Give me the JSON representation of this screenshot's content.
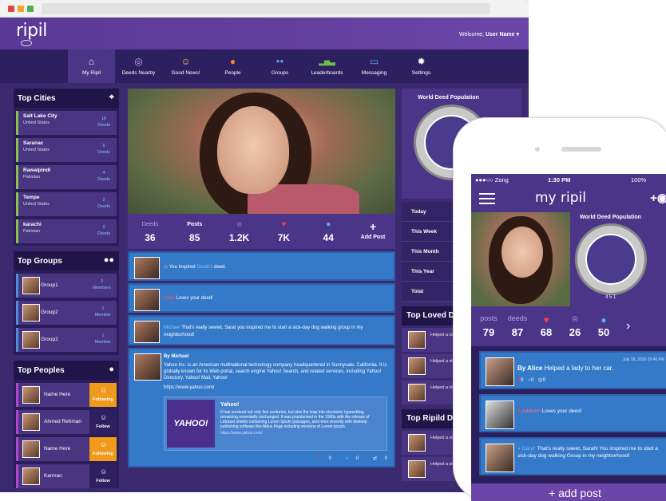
{
  "desktop": {
    "logo": "ripil",
    "welcome": "Welcome,",
    "welcome_user": "User Name ▾",
    "nav": [
      {
        "label": "My Ripil",
        "icon": "home-icon",
        "glyph": "⌂"
      },
      {
        "label": "Deeds Nearby",
        "icon": "ripple-icon",
        "glyph": "◎"
      },
      {
        "label": "Good News!",
        "icon": "smile-icon",
        "glyph": "☺"
      },
      {
        "label": "People",
        "icon": "person-icon",
        "glyph": "●"
      },
      {
        "label": "Groups",
        "icon": "group-icon",
        "glyph": "●●"
      },
      {
        "label": "Leaderboards",
        "icon": "bar-chart-icon",
        "glyph": "▂▅▃"
      },
      {
        "label": "Messaging",
        "icon": "chat-icon",
        "glyph": "▭"
      },
      {
        "label": "Settings",
        "icon": "gear-icon",
        "glyph": "✹"
      }
    ],
    "top_cities": {
      "title": "Top Cities",
      "items": [
        {
          "city": "Salt Lake City",
          "country": "United States",
          "count": "18",
          "unit": "Deeds"
        },
        {
          "city": "Saranac",
          "country": "United States",
          "count": "6",
          "unit": "Deeds"
        },
        {
          "city": "Rawalpindi",
          "country": "Pakistan",
          "count": "4",
          "unit": "Deeds"
        },
        {
          "city": "Tempe",
          "country": "United States",
          "count": "2",
          "unit": "Deeds"
        },
        {
          "city": "karachi",
          "country": "Pakistan",
          "count": "2",
          "unit": "Deeds"
        }
      ]
    },
    "top_groups": {
      "title": "Top Groups",
      "items": [
        {
          "name": "Group1",
          "count": "2",
          "unit": "Members"
        },
        {
          "name": "Group2",
          "count": "1",
          "unit": "Member"
        },
        {
          "name": "Group2",
          "count": "1",
          "unit": "Member"
        }
      ]
    },
    "top_peoples": {
      "title": "Top Peoples",
      "items": [
        {
          "name": "Name Here",
          "action": "Following"
        },
        {
          "name": "Ahmed Rehman",
          "action": "Follow"
        },
        {
          "name": "Name Here",
          "action": "Following"
        },
        {
          "name": "Kamran",
          "action": "Follow"
        }
      ]
    },
    "stats": [
      {
        "label": "Deeds",
        "value": "36"
      },
      {
        "label": "Posts",
        "value": "85"
      },
      {
        "label": "",
        "value": "1.2K"
      },
      {
        "label": "",
        "value": "7K"
      },
      {
        "label": "",
        "value": "44"
      },
      {
        "label": "",
        "value": "Add Post"
      }
    ],
    "feed": {
      "p1_text": "You inspired",
      "p1_who": "Sarah's",
      "p1_tail": "deed.",
      "p2_who": "Daryl",
      "p2_text": "Loves your deed!",
      "p3_who": "Michael",
      "p3_text": "That's really sewwt, Sarat you inspired me to start a sick-day dog walking group in my neighborhood!",
      "p4_by": "By Michael",
      "p4_text": "Yahoo Inc. is an American multinational technology company headquartered in Sunnyvale, California. It is globally known for its Web portal, search engine Yahoo! Search, and related services, including Yahoo! Directory, Yahoo! Mail, Yahoo!",
      "p4_link": "https://www.yahoo.com/",
      "card_logo": "YAHOO!",
      "card_title": "Yahoo!",
      "card_text": "It has survived not only five centuries, but also the leap into electronic typesetting, remaining essentially unchanged. It was popularised in the 1960s with the release of Letraset sheets containing Lorem Ipsum passages, and more recently with desktop publishing software like Aldus Page including versions of Lorem Ipsum.",
      "card_link": "https://www.yahoo.com/",
      "likes": "0",
      "comments": "0",
      "shares": "0"
    },
    "gauge_title": "World Deed Population",
    "periods": [
      "Today",
      "This Week",
      "This Month",
      "This Year",
      "Total"
    ],
    "top_loved": {
      "title": "Top Loved De",
      "items": [
        "Helped a stanger",
        "Helped a stanger",
        "Helped a stanger"
      ]
    },
    "top_ripild": {
      "title": "Top Ripild De",
      "items": [
        "Helped a stanger",
        "Helped a stanger"
      ]
    }
  },
  "phone": {
    "carrier": "●●●○○ Zong",
    "time": "1:30 PM",
    "battery": "100%",
    "title": "my ripil",
    "gauge_title": "World Deed Population",
    "gauge_count": "4 5 1",
    "stats": [
      {
        "label": "posts",
        "value": "79"
      },
      {
        "label": "deeds",
        "value": "87"
      },
      {
        "label": "",
        "value": "68"
      },
      {
        "label": "",
        "value": "26"
      },
      {
        "label": "",
        "value": "50"
      }
    ],
    "card1_date": "July 18, 2016 09:46 PM",
    "card1_by": "By Alice",
    "card1_text": "Helped a lady to her car.",
    "card1_likes": "0",
    "card1_comments": "0",
    "card1_ripples": "0",
    "card2_who": "Addison",
    "card2_text": "Loves your deed!",
    "card3_who": "Daryl:",
    "card3_text": "That's really sweet, Sarah! You inspired me to start a sick-day dog walking Group in my neighborhood!",
    "bottom": "+ add post"
  },
  "colors": {
    "accent": "#6b45a8",
    "nav": "#2d2060",
    "feed": "#3579c9",
    "following": "#f09a1c",
    "heart": "#ff3b4e",
    "link": "#7ec8ff"
  }
}
